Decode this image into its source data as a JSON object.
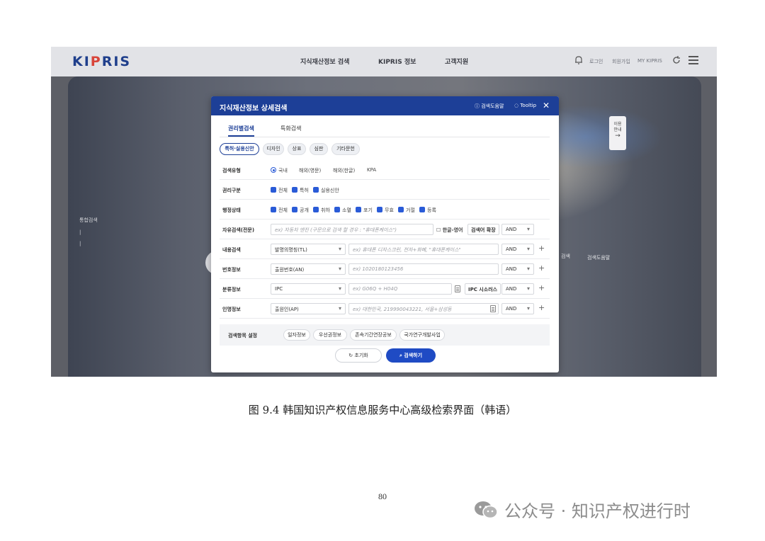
{
  "header": {
    "logo": [
      "KI",
      "P",
      "RIS"
    ],
    "nav": [
      "지식재산정보 검색",
      "KIPRIS 정보",
      "고객지원"
    ],
    "utility": [
      "로그인",
      "회원가입",
      "MY KIPRIS"
    ]
  },
  "hero": {
    "side_menu": [
      "통합검색",
      "|",
      "|"
    ],
    "search_button": "검색",
    "search_help": "검색도움말",
    "guide": [
      "이용",
      "안내",
      "→"
    ]
  },
  "modal": {
    "title": "지식재산정보 상세검색",
    "help_link": "검색도움말",
    "tooltip_link": "Tooltip",
    "close": "✕",
    "tabs": [
      "권리별검색",
      "특화검색"
    ],
    "chips": [
      "특허·실용신안",
      "디자인",
      "상표",
      "심판",
      "기타문헌"
    ],
    "rows": {
      "search_type": {
        "label": "검색유형",
        "options": [
          "국내",
          "해외(영문)",
          "해외(한글)",
          "KPA"
        ]
      },
      "right_type": {
        "label": "권리구분",
        "options": [
          "전체",
          "특허",
          "실용신안"
        ]
      },
      "admin_status": {
        "label": "행정상태",
        "options": [
          "전체",
          "공개",
          "취하",
          "소멸",
          "포기",
          "무효",
          "거절",
          "등록"
        ]
      },
      "free_search": {
        "label": "자유검색(전문)",
        "placeholder": "ex) 자동차 엔진 (구문으로 검색 할 경우 : \"휴대폰케이스\")",
        "toggle": "한글-영어",
        "expand": "검색어 확장",
        "op": "AND"
      },
      "content": {
        "label": "내용검색",
        "field": "발명의명칭(TL)",
        "placeholder": "ex) 휴대폰 디자스크린, 전자+화폐, \"휴대폰케이스\"",
        "op": "AND"
      },
      "number": {
        "label": "번호정보",
        "field": "출원번호(AN)",
        "placeholder": "ex) 1020180123456",
        "op": "AND"
      },
      "class": {
        "label": "분류정보",
        "field": "IPC",
        "placeholder": "ex) G06Q + H04Q",
        "thesaurus": "IPC 시소러스",
        "op": "AND"
      },
      "person": {
        "label": "인명정보",
        "field": "출원인(AP)",
        "placeholder": "ex) 대한민국, 219990043221, 서울+삼성동",
        "op": "AND"
      }
    },
    "settings": {
      "label": "검색항목 설정",
      "pills": [
        "일자정보",
        "우선권정보",
        "존속기간연장공보",
        "국가연구개발사업"
      ]
    },
    "reset": "초기화",
    "submit": "검색하기"
  },
  "caption": "图 9.4  韩国知识产权信息服务中心高级检索界面（韩语）",
  "page_number": "80",
  "watermark": "公众号 · 知识产权进行时",
  "colors": {
    "primary": "#1d3f97",
    "accent_button": "#1f4bc4",
    "checkbox": "#2a5bd7",
    "logo_red": "#d8443a"
  }
}
